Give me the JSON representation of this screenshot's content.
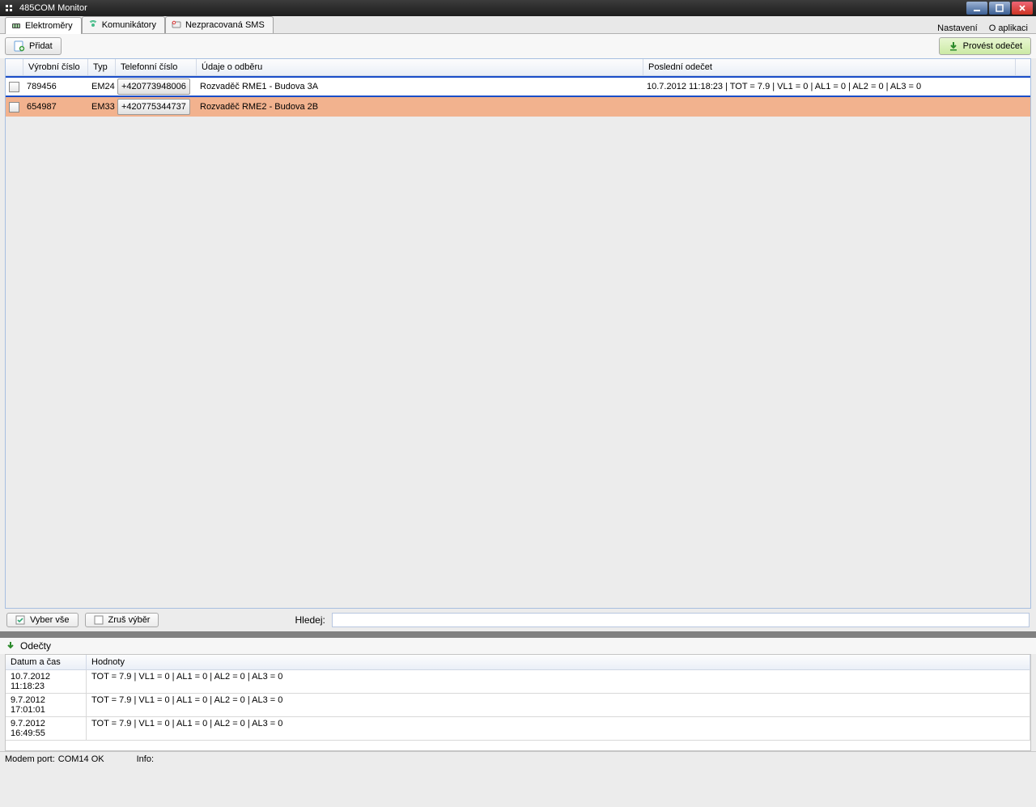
{
  "window": {
    "title": "485COM Monitor"
  },
  "tabs": {
    "items": [
      {
        "label": "Elektroměry"
      },
      {
        "label": "Komunikátory"
      },
      {
        "label": "Nezpracovaná SMS"
      }
    ]
  },
  "menu": {
    "settings": "Nastavení",
    "about": "O aplikaci"
  },
  "toolbar": {
    "add": "Přidat",
    "doReading": "Provést odečet"
  },
  "grid": {
    "headers": {
      "serial": "Výrobní číslo",
      "type": "Typ",
      "phone": "Telefonní číslo",
      "info": "Údaje o odběru",
      "last": "Poslední odečet"
    },
    "rows": [
      {
        "serial": "789456",
        "type": "EM24",
        "phone": "+420773948006",
        "info": "Rozvaděč RME1 - Budova 3A",
        "last": "10.7.2012 11:18:23 | TOT = 7.9 | VL1 = 0 | AL1 = 0 | AL2 = 0 | AL3 = 0"
      },
      {
        "serial": "654987",
        "type": "EM33",
        "phone": "+420775344737",
        "info": "Rozvaděč RME2 - Budova 2B",
        "last": ""
      }
    ]
  },
  "bottom": {
    "selectAll": "Vyber vše",
    "clearSel": "Zruš výběr",
    "searchLbl": "Hledej:"
  },
  "section": {
    "readings": "Odečty"
  },
  "readings": {
    "headers": {
      "dt": "Datum a čas",
      "val": "Hodnoty"
    },
    "rows": [
      {
        "dt": "10.7.2012 11:18:23",
        "val": "TOT = 7.9 | VL1 = 0 | AL1 = 0 | AL2 = 0 | AL3 = 0"
      },
      {
        "dt": "9.7.2012 17:01:01",
        "val": "TOT = 7.9 | VL1 = 0 | AL1 = 0 | AL2 = 0 | AL3 = 0"
      },
      {
        "dt": "9.7.2012 16:49:55",
        "val": "TOT = 7.9 | VL1 = 0 | AL1 = 0 | AL2 = 0 | AL3 = 0"
      }
    ]
  },
  "status": {
    "modemLabel": "Modem port:",
    "modemValue": "COM14 OK",
    "infoLabel": "Info:"
  }
}
